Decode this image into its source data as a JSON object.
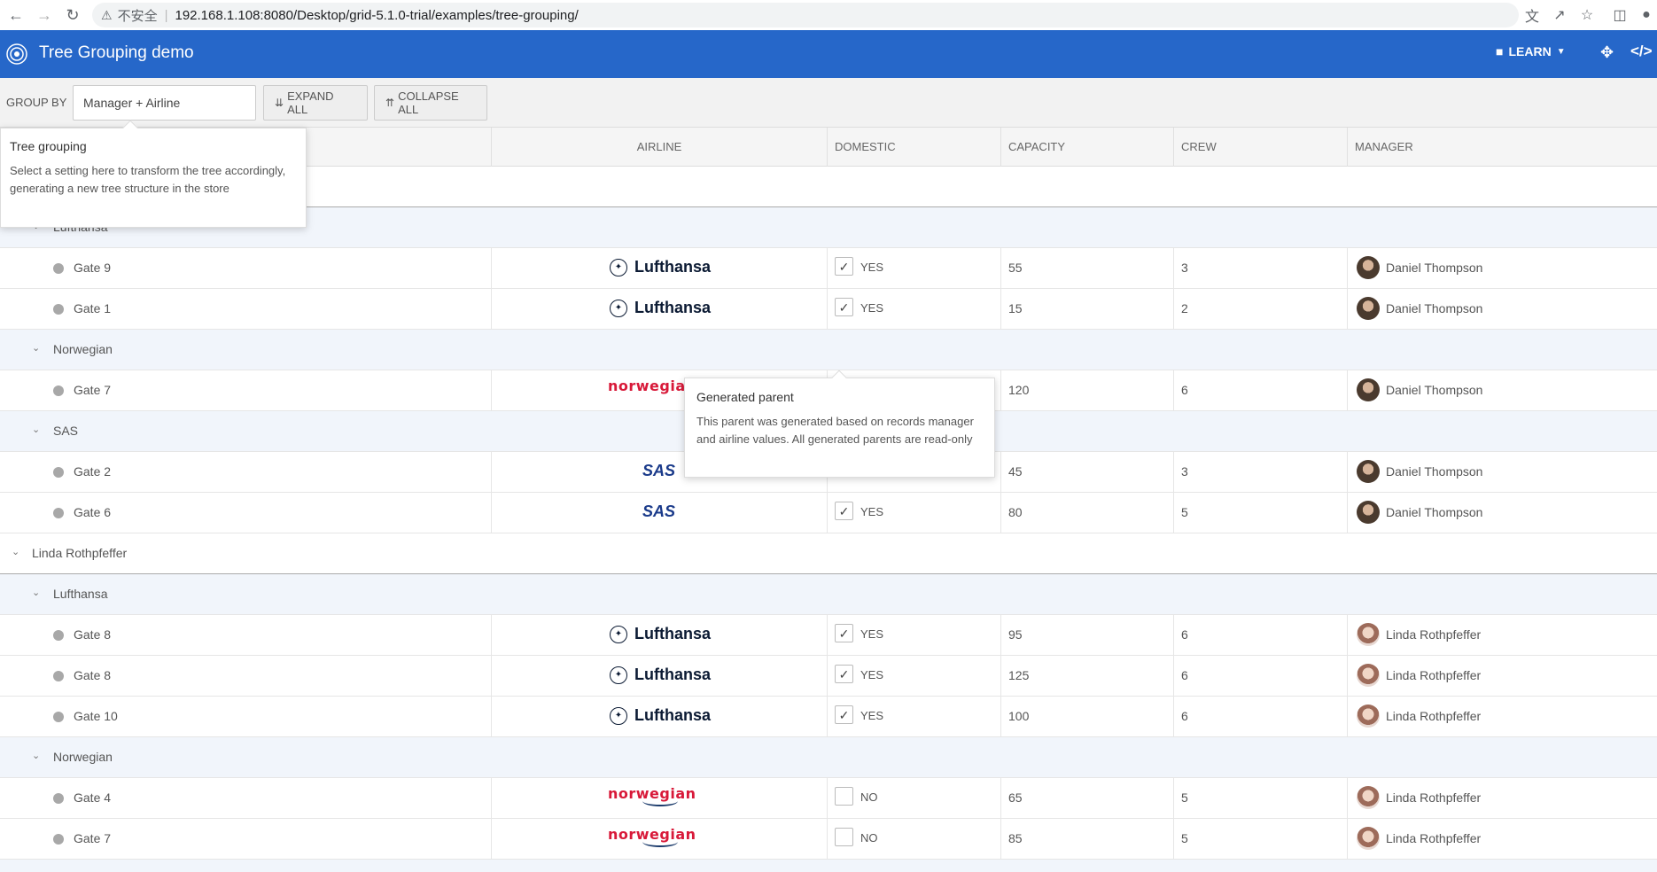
{
  "browser": {
    "insecure_label": "不安全",
    "url": "192.168.1.108:8080/Desktop/grid-5.1.0-trial/examples/tree-grouping/"
  },
  "app": {
    "title": "Tree Grouping demo",
    "learn_label": "LEARN",
    "accent_color": "#2667c9"
  },
  "toolbar": {
    "group_by_label": "GROUP BY",
    "group_by_value": "Manager + Airline",
    "expand_all_label": "EXPAND ALL",
    "collapse_all_label": "COLLAPSE ALL"
  },
  "columns": {
    "airline": "AIRLINE",
    "domestic": "DOMESTIC",
    "capacity": "CAPACITY",
    "crew": "CREW",
    "manager": "MANAGER"
  },
  "tooltip_grouping": {
    "title": "Tree grouping",
    "body": "Select a setting here to transform the tree accordingly, generating a new tree structure in the store"
  },
  "tooltip_parent": {
    "title": "Generated parent",
    "body": "This parent was generated based on records manager and airline values. All generated parents are read-only"
  },
  "rows": {
    "g_lufthansa_1": "Lufthansa",
    "r1": {
      "name": "Gate 9",
      "airline": "Lufthansa",
      "domestic": "YES",
      "capacity": "55",
      "crew": "3",
      "manager": "Daniel Thompson"
    },
    "r2": {
      "name": "Gate 1",
      "airline": "Lufthansa",
      "domestic": "YES",
      "capacity": "15",
      "crew": "2",
      "manager": "Daniel Thompson"
    },
    "g_norwegian_1": "Norwegian",
    "r3": {
      "name": "Gate 7",
      "airline": "norwegian",
      "capacity": "120",
      "crew": "6",
      "manager": "Daniel Thompson"
    },
    "g_sas_1": "SAS",
    "r4": {
      "name": "Gate 2",
      "airline": "SAS",
      "capacity": "45",
      "crew": "3",
      "manager": "Daniel Thompson"
    },
    "r5": {
      "name": "Gate 6",
      "airline": "SAS",
      "domestic": "YES",
      "capacity": "80",
      "crew": "5",
      "manager": "Daniel Thompson"
    },
    "m_linda": "Linda Rothpfeffer",
    "g_lufthansa_2": "Lufthansa",
    "r6": {
      "name": "Gate 8",
      "airline": "Lufthansa",
      "domestic": "YES",
      "capacity": "95",
      "crew": "6",
      "manager": "Linda Rothpfeffer"
    },
    "r7": {
      "name": "Gate 8",
      "airline": "Lufthansa",
      "domestic": "YES",
      "capacity": "125",
      "crew": "6",
      "manager": "Linda Rothpfeffer"
    },
    "r8": {
      "name": "Gate 10",
      "airline": "Lufthansa",
      "domestic": "YES",
      "capacity": "100",
      "crew": "6",
      "manager": "Linda Rothpfeffer"
    },
    "g_norwegian_2": "Norwegian",
    "r9": {
      "name": "Gate 4",
      "airline": "norwegian",
      "domestic": "NO",
      "capacity": "65",
      "crew": "5",
      "manager": "Linda Rothpfeffer"
    },
    "r10": {
      "name": "Gate 7",
      "airline": "norwegian",
      "domestic": "NO",
      "capacity": "85",
      "crew": "5",
      "manager": "Linda Rothpfeffer"
    }
  }
}
